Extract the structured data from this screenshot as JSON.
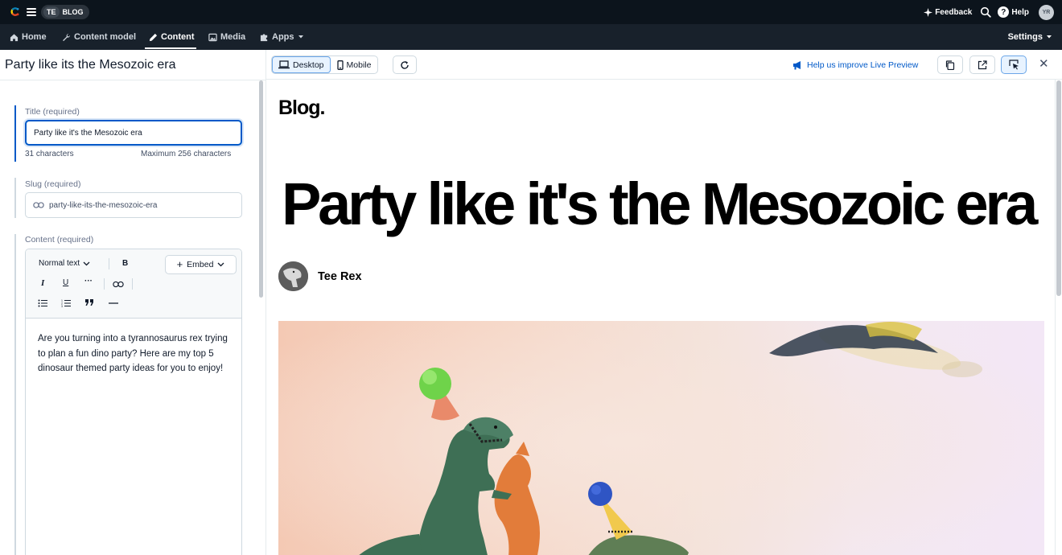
{
  "topbar": {
    "space_abbr": "TE",
    "space_name": "BLOG",
    "feedback_label": "Feedback",
    "help_label": "Help",
    "user_initials": "YR"
  },
  "nav": {
    "home": "Home",
    "content_model": "Content model",
    "content": "Content",
    "media": "Media",
    "apps": "Apps",
    "settings": "Settings"
  },
  "entry": {
    "header_title": "Party like its the Mesozoic era",
    "title_label": "Title (required)",
    "title_value": "Party like it's the Mesozoic era",
    "char_count": "31 characters",
    "max_chars": "Maximum 256 characters",
    "slug_label": "Slug (required)",
    "slug_value": "party-like-its-the-mesozoic-era",
    "content_label": "Content (required)",
    "content_text": "Are you turning into a tyrannosaurus rex trying to plan a fun dino party? Here are my top 5 dinosaur themed party ideas for you to enjoy!"
  },
  "rte_toolbar": {
    "style_select": "Normal text",
    "bold": "B",
    "italic": "I",
    "underline": "U",
    "more": "···",
    "embed": "Embed"
  },
  "preview_toolbar": {
    "desktop": "Desktop",
    "mobile": "Mobile",
    "improve_link": "Help us improve Live Preview"
  },
  "preview": {
    "blog_logo": "Blog.",
    "post_title": "Party like it's the Mesozoic era",
    "author_name": "Tee Rex"
  },
  "colors": {
    "topbar_bg": "#0c141c",
    "navbar_bg": "#18212b",
    "accent_blue": "#0059c8",
    "border": "#cfd9e0"
  }
}
